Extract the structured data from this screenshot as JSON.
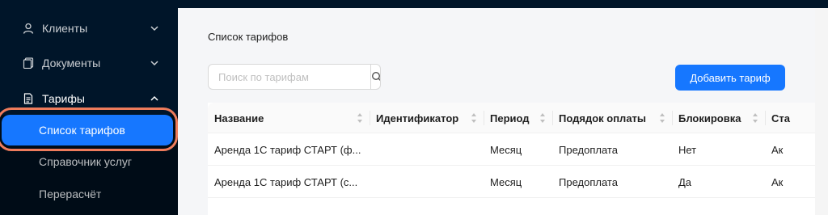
{
  "sidebar": {
    "items": [
      {
        "label": "Клиенты",
        "icon": "user-icon"
      },
      {
        "label": "Документы",
        "icon": "documents-icon"
      },
      {
        "label": "Тарифы",
        "icon": "tariff-icon"
      }
    ],
    "subitems": [
      {
        "label": "Список тарифов",
        "active": true
      },
      {
        "label": "Справочник услуг",
        "active": false
      },
      {
        "label": "Перерасчёт",
        "active": false
      }
    ]
  },
  "page": {
    "title": "Список тарифов"
  },
  "search": {
    "placeholder": "Поиск по тарифам",
    "value": ""
  },
  "toolbar": {
    "add_label": "Добавить тариф"
  },
  "table": {
    "columns": [
      "Название",
      "Идентификатор",
      "Период",
      "Подядок оплаты",
      "Блокировка",
      "Ста"
    ],
    "rows": [
      [
        "Аренда 1С тариф СТАРТ (ф...",
        "",
        "Месяц",
        "Предоплата",
        "Нет",
        "Ак"
      ],
      [
        "Аренда 1С тариф СТАРТ (с...",
        "",
        "Месяц",
        "Предоплата",
        "Да",
        "Ак"
      ]
    ]
  },
  "colors": {
    "sidebar_bg": "#001529",
    "accent": "#1677ff",
    "highlight": "#ee7c5c"
  }
}
